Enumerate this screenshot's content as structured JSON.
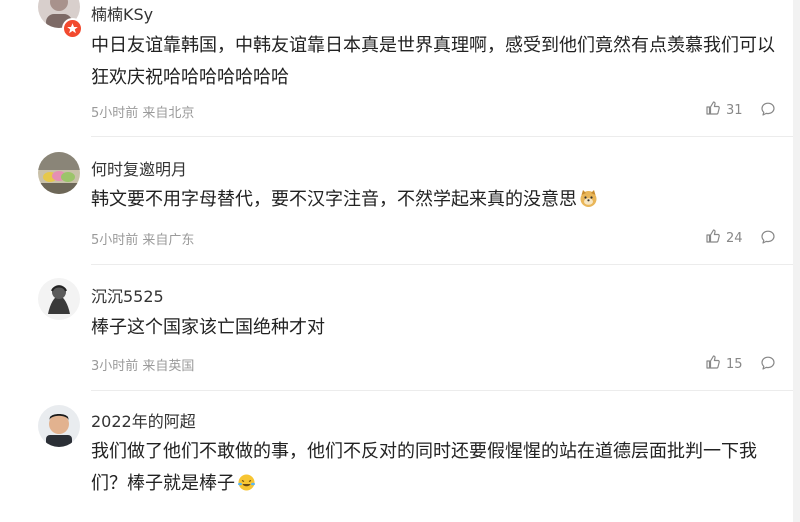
{
  "comments": [
    {
      "username": "楠楠KSy",
      "content": "中日友谊靠韩国，中韩友谊靠日本真是世界真理啊，感受到他们竟然有点羡慕我们可以狂欢庆祝哈哈哈哈哈哈哈",
      "meta": "5小时前 来自北京",
      "likes": "31",
      "avatar_icon": "user-avatar-with-badge",
      "badge_icon": "verified-badge-icon",
      "badge_color": "#f24a2f"
    },
    {
      "username": "何时复邀明月",
      "content": "韩文要不用字母替代，要不汉字注音，不然学起来真的没意思",
      "emoji": "doge-emoji",
      "meta": "5小时前 来自广东",
      "likes": "24",
      "avatar_icon": "user-avatar-macarons"
    },
    {
      "username": "沉沉5525",
      "content": "棒子这个国家该亡国绝种才对",
      "meta": "3小时前 来自英国",
      "likes": "15",
      "avatar_icon": "user-avatar-sketch"
    },
    {
      "username": "2022年的阿超",
      "content": "我们做了他们不敢做的事，他们不反对的同时还要假惺惺的站在道德层面批判一下我们？棒子就是棒子",
      "emoji": "laugh-cry-emoji",
      "meta": "",
      "likes": "",
      "avatar_icon": "user-avatar-portrait"
    }
  ],
  "icons": {
    "like": "thumbs-up-icon",
    "reply": "comment-bubble-icon"
  },
  "colors": {
    "text": "#222222",
    "meta": "#9a9a9a",
    "divider": "#ececec",
    "badge": "#f24a2f"
  }
}
